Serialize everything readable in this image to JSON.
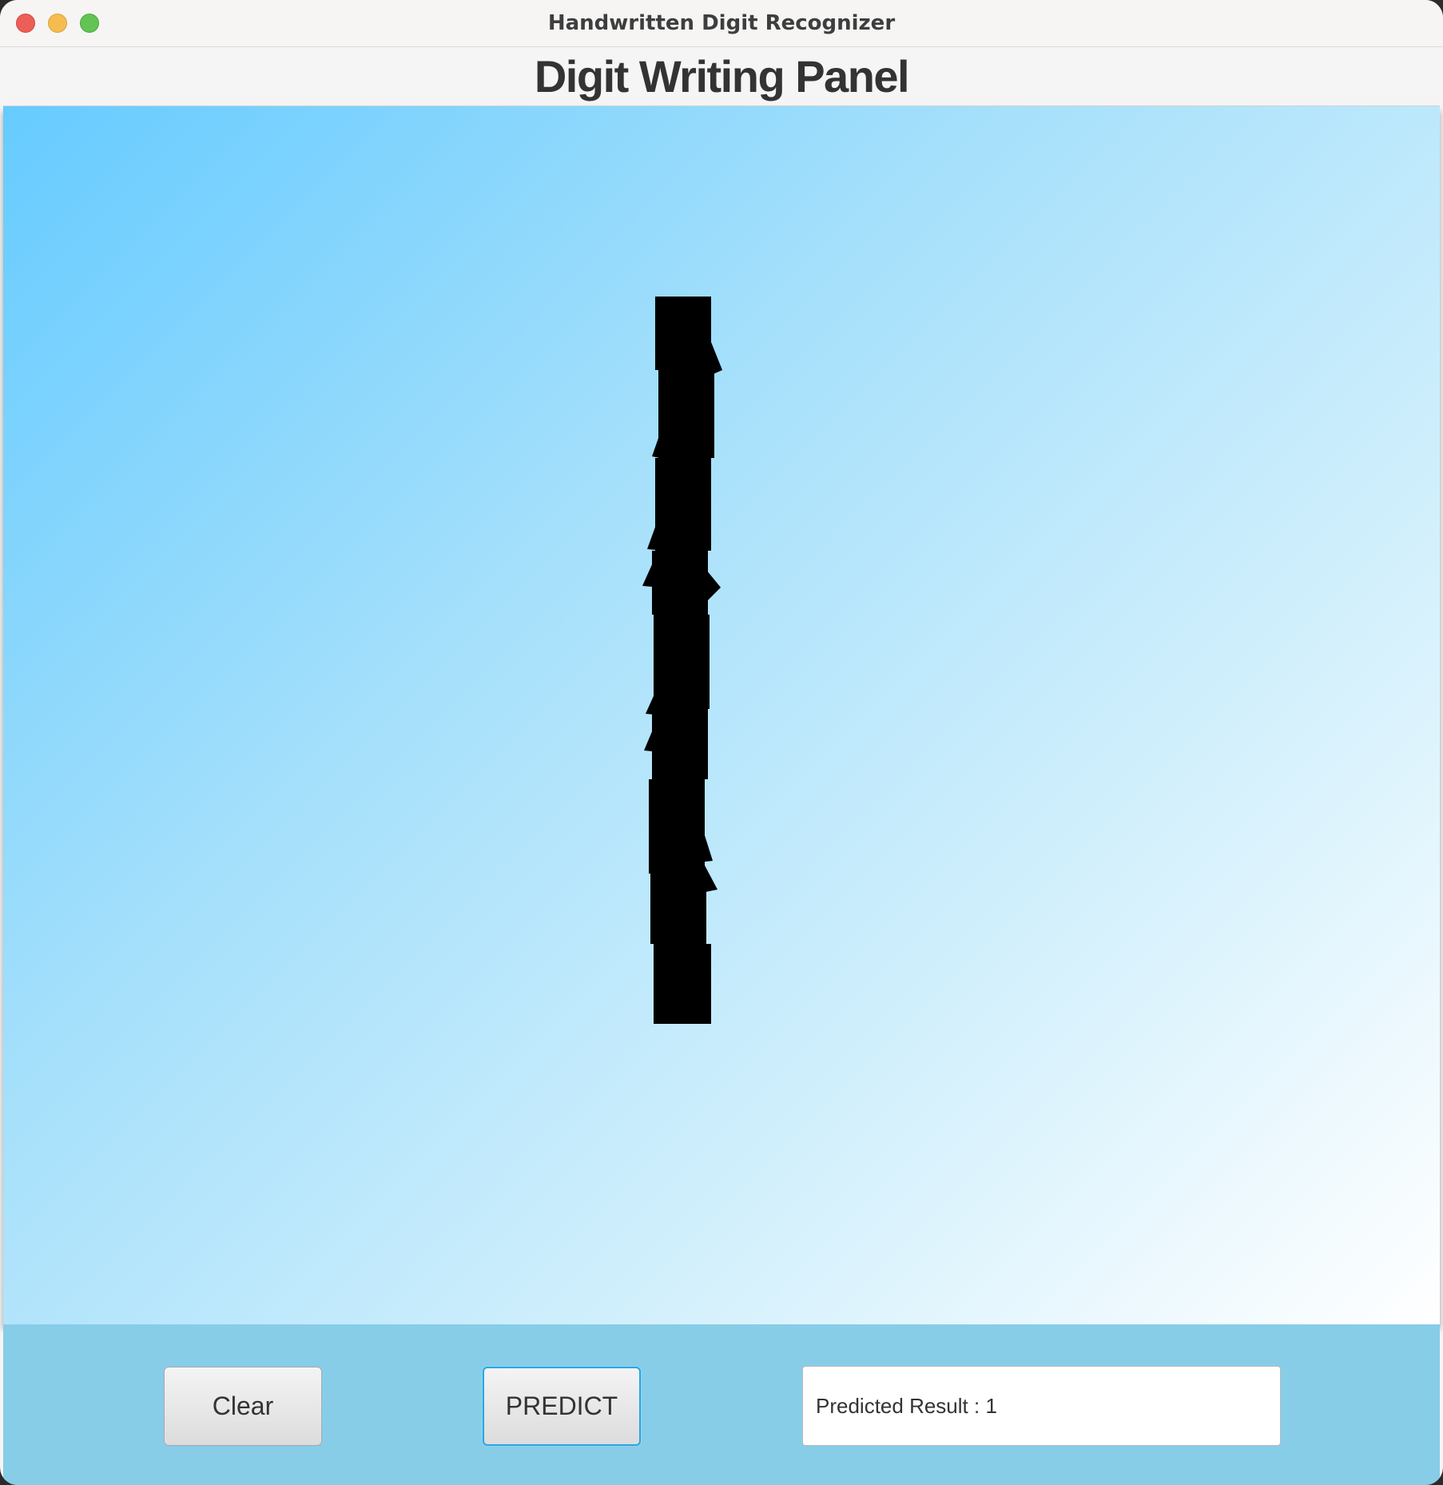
{
  "window": {
    "title": "Handwritten Digit Recognizer",
    "controls": [
      "close",
      "minimize",
      "maximize"
    ]
  },
  "panel": {
    "title": "Digit Writing Panel",
    "background_gradient": [
      "#66cbff",
      "#a6e0fb",
      "#cdeefc",
      "#ffffff"
    ],
    "stroke_color": "#000000",
    "drawn_digit": "1"
  },
  "controls": {
    "clear_label": "Clear",
    "predict_label": "PREDICT",
    "bar_color": "#87cde8",
    "predict_focus_color": "#2aa6e3"
  },
  "result": {
    "label": "Predicted Result : ",
    "value": "1"
  }
}
